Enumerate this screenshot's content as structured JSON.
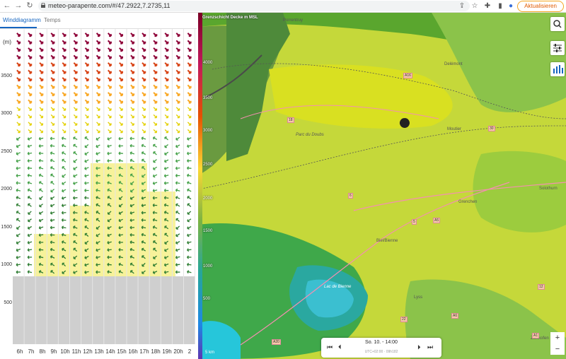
{
  "browser": {
    "url": "meteo-parapente.com/#/47.2922,7.2735,11",
    "update_label": "Aktualisieren"
  },
  "panel": {
    "tabs": [
      "Winddiagramm",
      "Temps"
    ],
    "unit": "(m)",
    "y_labels": [
      "3500",
      "3000",
      "2500",
      "2000",
      "1500",
      "1000",
      "500"
    ],
    "x_labels": [
      "6h",
      "7h",
      "8h",
      "9h",
      "10h",
      "11h",
      "12h",
      "13h",
      "14h",
      "15h",
      "16h",
      "17h",
      "18h",
      "19h",
      "20h",
      "2"
    ]
  },
  "map": {
    "scale_title": "Grenzschicht Decke m MSL",
    "scale_labels": [
      "4000",
      "3500",
      "3000",
      "2500",
      "2000",
      "1500",
      "1000",
      "500"
    ],
    "places": [
      "Porrentruy",
      "Delémont",
      "Parc du Doubs",
      "Moutier",
      "Grenchen",
      "Solothurn",
      "Biel/Bienne",
      "Lac de Bienne",
      "Lyss",
      "Zollikofen"
    ],
    "roads": [
      "A16",
      "A5",
      "A6",
      "A1",
      "A20",
      "18",
      "30",
      "6",
      "5",
      "22",
      "12"
    ],
    "time_title": "So. 10. - 14:00",
    "time_sub": "UTC+02:00 · 09h182",
    "scale": "5 km",
    "zoom_in": "+",
    "zoom_out": "−"
  },
  "colors": {
    "accent": "#1565c0",
    "update": "#e05a00"
  }
}
